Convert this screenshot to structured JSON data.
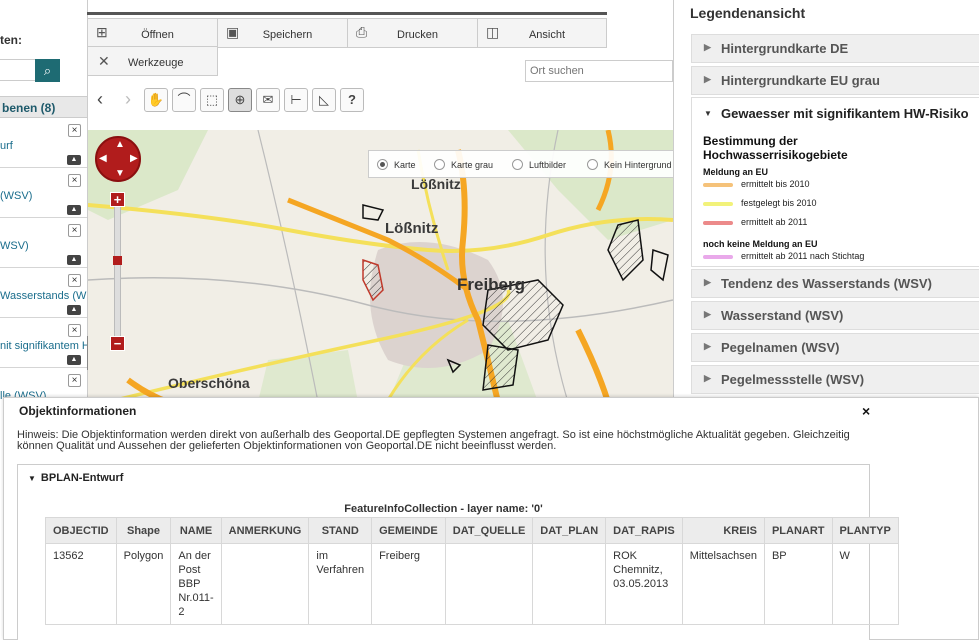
{
  "left_panel": {
    "label": "ten:",
    "search_icon": "search-icon",
    "header": "benen (8)",
    "items": [
      {
        "label": "urf"
      },
      {
        "label": "(WSV)"
      },
      {
        "label": "WSV)"
      },
      {
        "label": "Wasserstands (W"
      },
      {
        "label": "nit signifikantem H"
      },
      {
        "label": "lle (WSV)"
      }
    ]
  },
  "menu": {
    "oeffnen": "Öffnen",
    "speichern": "Speichern",
    "drucken": "Drucken",
    "ansicht": "Ansicht",
    "werkzeuge": "Werkzeuge"
  },
  "search": {
    "placeholder": "Ort suchen"
  },
  "tools": {
    "help": "?"
  },
  "map": {
    "labels": {
      "loessnitz_top": "Lößnitz",
      "loessnitz": "Lößnitz",
      "freiberg": "Freiberg",
      "oberschoena": "Oberschöna"
    },
    "basemap_options": [
      {
        "label": "Karte",
        "selected": true
      },
      {
        "label": "Karte grau",
        "selected": false
      },
      {
        "label": "Luftbilder",
        "selected": false
      },
      {
        "label": "Kein Hintergrund",
        "selected": false
      }
    ]
  },
  "legend": {
    "title": "Legendenansicht",
    "rows_top": [
      "Hintergrundkarte DE",
      "Hintergrundkarte EU grau"
    ],
    "open_layer": {
      "name": "Gewaesser mit signifikantem HW-Risiko",
      "heading_line1": "Bestimmung der",
      "heading_line2": "Hochwasserrisikogebiete",
      "group1": "Meldung an EU",
      "entries1": [
        {
          "label": "ermittelt bis 2010",
          "color": "#f5c27a"
        },
        {
          "label": "festgelegt bis 2010",
          "color": "#f2f27a"
        },
        {
          "label": "ermittelt ab 2011",
          "color": "#ec8a8a"
        }
      ],
      "group2": "noch keine Meldung an EU",
      "entries2": [
        {
          "label": "ermittelt ab 2011 nach Stichtag",
          "color": "#e9a9ea"
        }
      ]
    },
    "rows_bottom": [
      "Tendenz des Wasserstands (WSV)",
      "Wasserstand (WSV)",
      "Pegelnamen (WSV)",
      "Pegelmessstelle (WSV)"
    ]
  },
  "info": {
    "title": "Objektinformationen",
    "close": "×",
    "hint": "Hinweis: Die Objektinformation werden direkt von außerhalb des Geoportal.DE gepflegten Systemen angefragt. So ist eine höchstmögliche Aktualität gegeben. Gleichzeitig können Qualität und Aussehen der gelieferten Objektinformationen von Geoportal.DE nicht beeinflusst werden.",
    "section": "BPLAN-Entwurf",
    "caption": "FeatureInfoCollection - layer name: '0'",
    "columns": [
      "OBJECTID",
      "Shape",
      "NAME",
      "ANMERKUNG",
      "STAND",
      "GEMEINDE",
      "DAT_QUELLE",
      "DAT_PLAN",
      "DAT_RAPIS",
      "KREIS",
      "PLANART",
      "PLANTYP"
    ],
    "row": {
      "objectid": "13562",
      "shape": "Polygon",
      "name": "An der Post BBP Nr.011-2",
      "anmerkung": "",
      "stand": "im Verfahren",
      "gemeinde": "Freiberg",
      "dat_quelle": "",
      "dat_plan": "",
      "dat_rapis": "ROK Chemnitz, 03.05.2013",
      "kreis": "Mittelsachsen",
      "planart": "BP",
      "plantyp": "W"
    }
  }
}
